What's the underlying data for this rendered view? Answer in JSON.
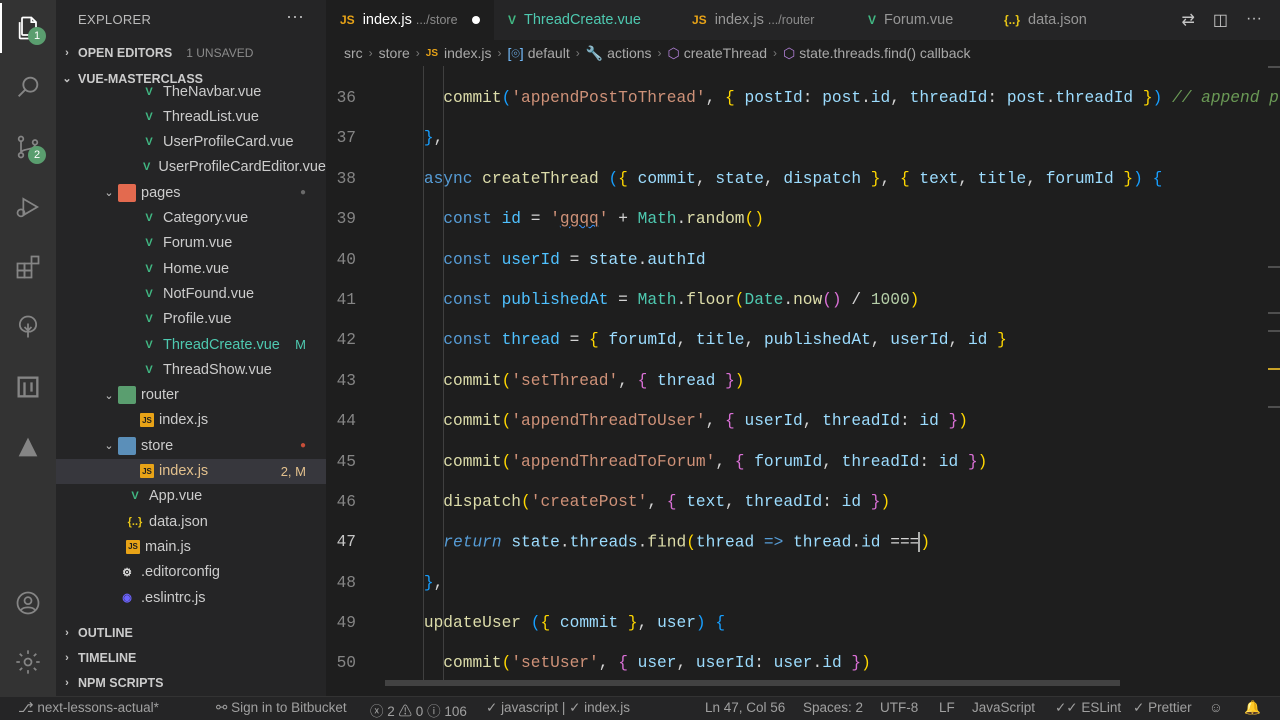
{
  "activity": {
    "scm_badge": "2",
    "explorer_badge": "1"
  },
  "sidebar": {
    "title": "EXPLORER",
    "more": "···",
    "open_editors": "OPEN EDITORS",
    "unsaved": "1 UNSAVED",
    "project": "VUE-MASTERCLASS",
    "items": [
      {
        "label": "TheNavbar.vue",
        "icon": "vue-icon",
        "dec": ""
      },
      {
        "label": "ThreadList.vue",
        "icon": "vue-icon",
        "dec": ""
      },
      {
        "label": "UserProfileCard.vue",
        "icon": "vue-icon",
        "dec": ""
      },
      {
        "label": "UserProfileCardEditor.vue",
        "icon": "vue-icon",
        "dec": ""
      },
      {
        "label": "pages",
        "icon": "folder-icon",
        "dec": "●"
      },
      {
        "label": "Category.vue",
        "icon": "vue-icon",
        "dec": ""
      },
      {
        "label": "Forum.vue",
        "icon": "vue-icon",
        "dec": ""
      },
      {
        "label": "Home.vue",
        "icon": "vue-icon",
        "dec": ""
      },
      {
        "label": "NotFound.vue",
        "icon": "vue-icon",
        "dec": ""
      },
      {
        "label": "Profile.vue",
        "icon": "vue-icon",
        "dec": ""
      },
      {
        "label": "ThreadCreate.vue",
        "icon": "vue-icon",
        "dec": "M"
      },
      {
        "label": "ThreadShow.vue",
        "icon": "vue-icon",
        "dec": ""
      },
      {
        "label": "router",
        "icon": "folder-icon",
        "dec": ""
      },
      {
        "label": "index.js",
        "icon": "js-icon",
        "dec": ""
      },
      {
        "label": "store",
        "icon": "folder-icon",
        "dec": "●"
      },
      {
        "label": "index.js",
        "icon": "js-icon",
        "dec": "2, M"
      },
      {
        "label": "App.vue",
        "icon": "vue-icon",
        "dec": ""
      },
      {
        "label": "data.json",
        "icon": "json-icon",
        "dec": ""
      },
      {
        "label": "main.js",
        "icon": "js-icon",
        "dec": ""
      },
      {
        "label": ".editorconfig",
        "icon": "gear-icon",
        "dec": ""
      },
      {
        "label": ".eslintrc.js",
        "icon": "eslint-icon",
        "dec": ""
      }
    ],
    "outline": "OUTLINE",
    "timeline": "TIMELINE",
    "npm_scripts": "NPM SCRIPTS"
  },
  "tabs": [
    {
      "label": "index.js",
      "sub": ".../store",
      "active": true
    },
    {
      "label": "ThreadCreate.vue",
      "sub": ""
    },
    {
      "label": "index.js",
      "sub": ".../router"
    },
    {
      "label": "Forum.vue",
      "sub": ""
    },
    {
      "label": "data.json",
      "sub": ""
    }
  ],
  "breadcrumb": [
    "src",
    "store",
    "index.js",
    "default",
    "actions",
    "createThread",
    "state.threads.find() callback"
  ],
  "editor": {
    "line_numbers": [
      "36",
      "37",
      "38",
      "39",
      "40",
      "41",
      "42",
      "43",
      "44",
      "45",
      "46",
      "47",
      "48",
      "49",
      "50"
    ]
  },
  "status": {
    "branch": "next-lessons-actual*",
    "bitbucket": "Sign in to Bitbucket",
    "errors": "2",
    "warnings": "0",
    "info": "106",
    "lang_check": "javascript",
    "file_check": "index.js",
    "position": "Ln 47, Col 56",
    "spaces": "Spaces: 2",
    "encoding": "UTF-8",
    "eol": "LF",
    "language": "JavaScript",
    "eslint": "ESLint",
    "prettier": "Prettier"
  }
}
